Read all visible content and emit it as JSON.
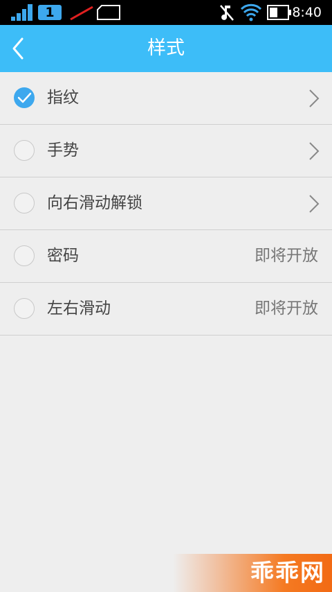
{
  "status_bar": {
    "sim_label": "1",
    "time": "8:40"
  },
  "header": {
    "title": "样式",
    "accent_color": "#3dbdf8"
  },
  "options": [
    {
      "label": "指纹",
      "checked": true,
      "trailing": "chevron"
    },
    {
      "label": "手势",
      "checked": false,
      "trailing": "chevron"
    },
    {
      "label": "向右滑动解锁",
      "checked": false,
      "trailing": "chevron"
    },
    {
      "label": "密码",
      "checked": false,
      "trailing_text": "即将开放"
    },
    {
      "label": "左右滑动",
      "checked": false,
      "trailing_text": "即将开放"
    }
  ],
  "watermark": {
    "text": "乖乖网"
  },
  "icons": {
    "back": "chevron-left-icon",
    "chevron": "chevron-right-icon",
    "check": "check-icon"
  }
}
